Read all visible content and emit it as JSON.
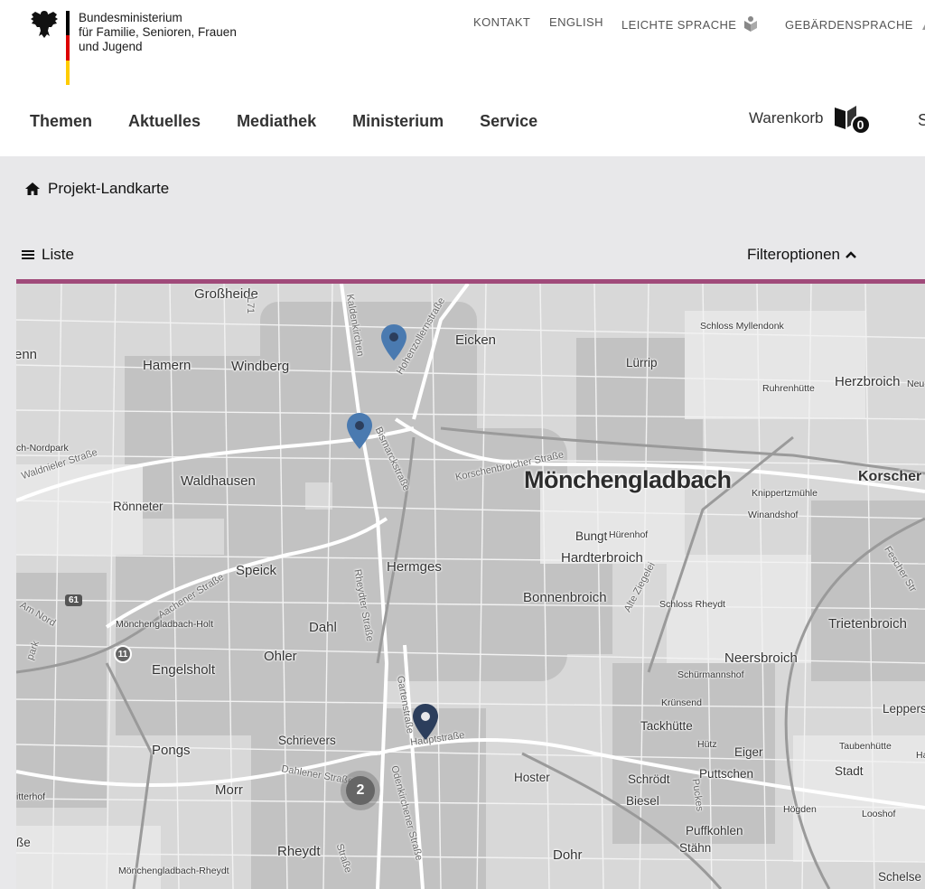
{
  "header": {
    "ministry_lines": [
      "Bundesministerium",
      "für Familie, Senioren, Frauen",
      "und Jugend"
    ],
    "flag_colors": [
      "#000000",
      "#dd0000",
      "#ffcc00"
    ],
    "top_links": {
      "kontakt": "KONTAKT",
      "english": "ENGLISH",
      "leichte_sprache": "LEICHTE SPRACHE",
      "gebaerdensprache": "GEBÄRDENSPRACHE"
    },
    "main_nav": [
      "Themen",
      "Aktuelles",
      "Mediathek",
      "Ministerium",
      "Service"
    ],
    "cart": {
      "label": "Warenkorb",
      "count": "0"
    },
    "search_cut": "S"
  },
  "breadcrumb": {
    "label": "Projekt-Landkarte"
  },
  "toolbar": {
    "list_label": "Liste",
    "filter_label": "Filteroptionen"
  },
  "accent_color": "#a04a7a",
  "map": {
    "city": "Mönchengladbach",
    "places": {
      "grossheide": "Großheide",
      "eicken": "Eicken",
      "hamern": "Hamern",
      "windberg": "Windberg",
      "luerrip": "Lürrip",
      "schloss_myllendonk": "Schloss Myllendonk",
      "ruhrenhuette": "Ruhrenhütte",
      "herzbroich": "Herzbroich",
      "neu": "Neu-",
      "waldhausen": "Waldhausen",
      "roenneter": "Rönneter",
      "korschenbroich": "Korscher",
      "knippertzmuehle": "Knippertzmühle",
      "winandshof": "Winandshof",
      "bungt": "Bungt",
      "huerenhof": "Hürenhof",
      "hardterbroich": "Hardterbroich",
      "speick": "Speick",
      "hermges": "Hermges",
      "bonnenbroich": "Bonnenbroich",
      "schloss_rheydt": "Schloss Rheydt",
      "dahl": "Dahl",
      "trietenbroich": "Trietenbroich",
      "moenchengladbach_holt": "Mönchengladbach-Holt",
      "engelsholt": "Engelsholt",
      "ohler": "Ohler",
      "neersbroich": "Neersbroich",
      "schuermannshof": "Schürmannshof",
      "kruensend": "Krünsend",
      "tackhuette": "Tackhütte",
      "leppers": "Leppers",
      "pongs": "Pongs",
      "schrievers": "Schrievers",
      "huetz": "Hütz",
      "eiger": "Eiger",
      "taubenhuette": "Taubenhütte",
      "ha": "Ha",
      "puttschen": "Puttschen",
      "stadt": "Stadt",
      "hoster": "Hoster",
      "schroedt": "Schrödt",
      "morr": "Morr",
      "biesel": "Biesel",
      "hoegden": "Högden",
      "looshof": "Looshof",
      "puffkohlen": "Puffkohlen",
      "staehn": "Stähn",
      "rheydt": "Rheydt",
      "dohr": "Dohr",
      "schelsen": "Schelse",
      "enn": "enn",
      "park": "ch-Nordpark",
      "itterhof": "itterhof",
      "sse": "ße",
      "mg_rheydt": "Mönchengladbach-Rheydt"
    },
    "roads": {
      "waldnieler": "Waldnieler Straße",
      "kaldenkirchen": "Kaldenkirchen",
      "hohenzollern": "Hohenzollernstraße",
      "korschenbroicher": "Korschenbroicher Straße",
      "bismarck": "Bismarckstraße",
      "aachener": "Aachener Straße",
      "rheydter": "Rheydter Straße",
      "alte_ziegelei": "Alte Ziegelei",
      "garten": "Gartenstraße",
      "haupt": "Hauptstraße",
      "dahlener": "Dahlener Straße",
      "odenkirchener": "Odenkirchener Straße",
      "puckes": "Puckes",
      "fescher": "Fescher Str",
      "am_nord": "Am Nord",
      "park_road": "park",
      "other_strasse": "Straße",
      "l_road": "L71"
    },
    "shields": {
      "a61": "61",
      "b11": "11"
    },
    "cluster_count": "2",
    "pin_colors": {
      "light": "#4a7ab0",
      "dark": "#2c3e5c"
    }
  }
}
